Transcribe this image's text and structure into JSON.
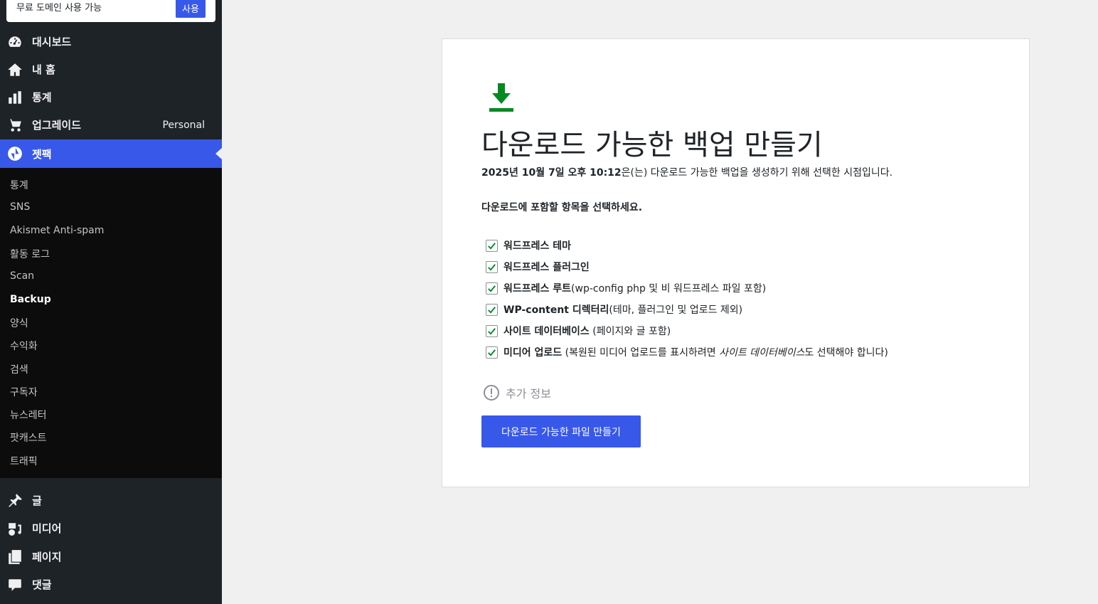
{
  "promo": {
    "text": "무료 도메인 사용 가능",
    "button": "사용"
  },
  "menu": {
    "dashboard": "대시보드",
    "home": "내 홈",
    "stats": "통계",
    "upgrades": "업그레이드",
    "upgrades_plan": "Personal",
    "jetpack": "젯팩",
    "posts": "글",
    "media": "미디어",
    "pages": "페이지",
    "comments": "댓글"
  },
  "submenu": [
    "통계",
    "SNS",
    "Akismet Anti-spam",
    "활동 로그",
    "Scan",
    "Backup",
    "양식",
    "수익화",
    "검색",
    "구독자",
    "뉴스레터",
    "팟캐스트",
    "트래픽"
  ],
  "main": {
    "title": "다운로드 가능한 백업 만들기",
    "subtitle_date": "2025년 10월 7일 오후 10:12",
    "subtitle_rest": "은(는) 다운로드 가능한 백업을 생성하기 위해 선택한 시점입니다.",
    "prompt": "다운로드에 포함할 항목을 선택하세요.",
    "items": [
      {
        "bold": "워드프레스 테마",
        "rest": ""
      },
      {
        "bold": "워드프레스 플러그인",
        "rest": ""
      },
      {
        "bold": "워드프레스 루트",
        "rest": "(wp-config php 및 비 워드프레스 파일 포함)"
      },
      {
        "bold": "WP-content 디렉터리",
        "rest": "(테마, 플러그인 및 업로드 제외)"
      },
      {
        "bold": "사이트 데이터베이스",
        "rest": " (페이지와 글 포함)"
      },
      {
        "bold": "미디어 업로드",
        "rest": " (복원된 미디어 업로드를 표시하려면 ",
        "italic": "사이트 데이터베이스",
        "rest2": "도 선택해야 합니다)"
      }
    ],
    "more_info": "추가 정보",
    "create_button": "다운로드 가능한 파일 만들기"
  },
  "colors": {
    "accent": "#3858e9",
    "sidebar": "#1d2327",
    "success": "#008a20"
  }
}
